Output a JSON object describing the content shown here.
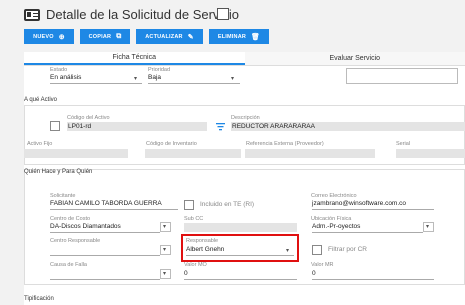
{
  "header": {
    "title": "Detalle de la Solicitud de Servicio"
  },
  "toolbar": {
    "nuevo": "NUEVO",
    "copiar": "COPIAR",
    "actualizar": "ACTUALIZAR",
    "eliminar": "ELIMINAR"
  },
  "tabs": {
    "ficha": "Ficha Técnica",
    "evaluar": "Evaluar Servicio"
  },
  "top": {
    "estado_label": "Estado",
    "estado_value": "En análisis",
    "prioridad_label": "Prioridad",
    "prioridad_value": "Baja"
  },
  "activo": {
    "section": "A qué Activo",
    "codigo_label": "Código del Activo",
    "codigo_value": "LP01-rd",
    "desc_label": "Descripción",
    "desc_value": "REDUCTOR ARARARARAA",
    "fijo_label": "Activo Fijo",
    "inventario_label": "Código de Inventario",
    "ref_label": "Referencia Externa (Proveedor)",
    "serial_label": "Serial"
  },
  "quien": {
    "section": "Quién Hace y Para Quién",
    "solicitante_label": "Solicitante",
    "solicitante_value": "FABIAN CAMILO TABORDA GUERRA",
    "incluido_label": "Incluido en TE (RI)",
    "correo_label": "Correo Electrónico",
    "correo_value": "jzambrano@winsoftware.com.co",
    "centro_costo_label": "Centro de Costo",
    "centro_costo_value": "DA-Discos Diamantados",
    "subcc_label": "Sub CC",
    "ubicacion_label": "Ubicación Física",
    "ubicacion_value": "Adm.-Pr-oyectos",
    "centro_resp_label": "Centro Responsable",
    "responsable_label": "Responsable",
    "responsable_value": "Albert Gnehn",
    "filtrar_label": "Filtrar por CR",
    "causa_label": "Causa de Falla",
    "valor_mo_label": "Valor MO",
    "valor_mo_value": "0",
    "valor_mr_label": "Valor MR",
    "valor_mr_value": "0"
  },
  "tipificacion": {
    "section": "Tipificación"
  },
  "colors": {
    "accent": "#1e88e5",
    "highlight": "#e01010"
  }
}
